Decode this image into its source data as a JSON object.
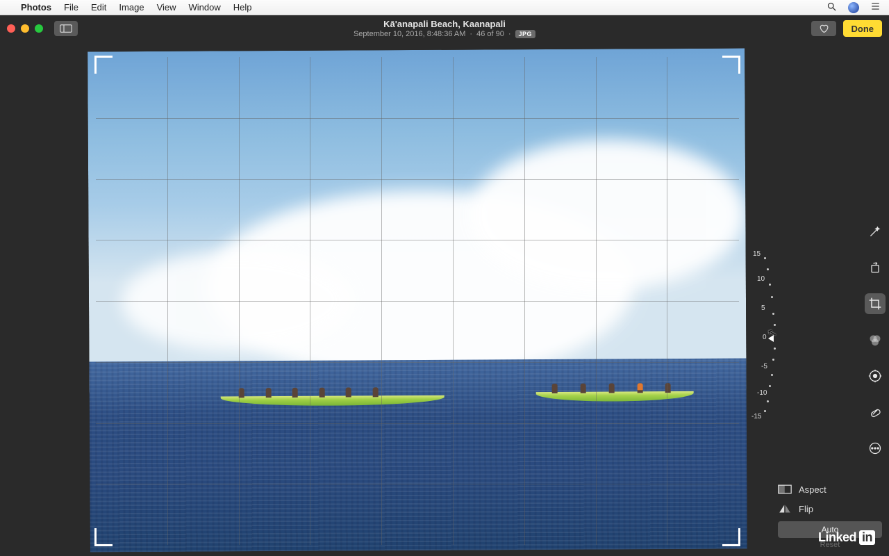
{
  "menubar": {
    "app": "Photos",
    "items": [
      "File",
      "Edit",
      "Image",
      "View",
      "Window",
      "Help"
    ]
  },
  "titlebar": {
    "title": "Kā'anapali Beach, Kaanapali",
    "date": "September 10, 2016, 8:48:36 AM",
    "counter": "46 of 90",
    "format_badge": "JPG",
    "done_label": "Done"
  },
  "dial": {
    "ticks": [
      "15",
      "10",
      "5",
      "0",
      "-5",
      "-10",
      "-15"
    ],
    "value": 0
  },
  "controls": {
    "aspect": "Aspect",
    "flip": "Flip",
    "auto": "Auto",
    "reset": "Reset"
  },
  "brand": {
    "name": "Linked",
    "suffix": "in"
  },
  "tools": [
    {
      "id": "magic-wand",
      "active": false
    },
    {
      "id": "rotate",
      "active": false
    },
    {
      "id": "crop",
      "active": true
    },
    {
      "id": "filters",
      "active": false
    },
    {
      "id": "adjust",
      "active": false
    },
    {
      "id": "retouch",
      "active": false
    },
    {
      "id": "more",
      "active": false
    }
  ]
}
